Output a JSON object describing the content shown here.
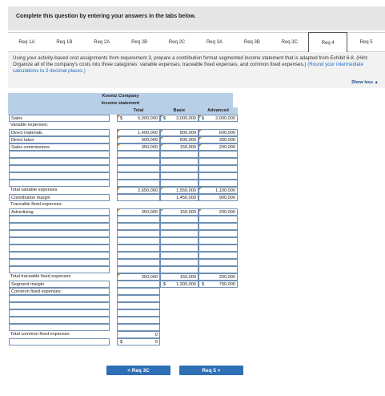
{
  "header": {
    "title": "Complete this question by entering your answers in the tabs below."
  },
  "tabs": [
    {
      "label": "Req 1A"
    },
    {
      "label": "Req 1B"
    },
    {
      "label": "Req 2A"
    },
    {
      "label": "Req 2B"
    },
    {
      "label": "Req 2C"
    },
    {
      "label": "Req 3A"
    },
    {
      "label": "Req 3B"
    },
    {
      "label": "Req 3C"
    },
    {
      "label": "Req 4"
    },
    {
      "label": "Req 5"
    }
  ],
  "active_tab": "Req 4",
  "instructions": {
    "text": "Using your activity-based cost assignments from requirement 3, prepare a contribution format segmented income statement that is adapted from Exhibit 6-8. (Hint: Organize all of the company's costs into three categories: variable expenses, traceable fixed expenses, and common fixed expenses.)",
    "note": "(Round your intermediate calculations to 2 decimal places.)",
    "show_less": "Show less ▲"
  },
  "statement": {
    "company": "Koontz Company",
    "title": "Income statement",
    "columns": [
      "Total",
      "Basic",
      "Advanced"
    ],
    "sales": {
      "label": "Sales",
      "total": "5,000,000",
      "basic": "3,000,000",
      "advanced": "2,000,000"
    },
    "variable_header": "Variable expenses:",
    "direct_materials": {
      "label": "Direct materials",
      "total": "1,400,000",
      "basic": "800,000",
      "advanced": "600,000"
    },
    "direct_labor": {
      "label": "Direct labor",
      "total": "900,000",
      "basic": "600,000",
      "advanced": "300,000"
    },
    "sales_commissions": {
      "label": "Sales commissions",
      "total": "350,000",
      "basic": "150,000",
      "advanced": "200,000"
    },
    "total_variable": {
      "label": "Total variable expenses",
      "total": "2,650,000",
      "basic": "1,550,000",
      "advanced": "1,100,000"
    },
    "contribution_margin": {
      "label": "Contribution margin",
      "basic": "1,450,000",
      "advanced": "900,000"
    },
    "traceable_header": "Traceable fixed expenses:",
    "advertising": {
      "label": "Advertising",
      "total": "350,000",
      "basic": "150,000",
      "advanced": "200,000"
    },
    "total_traceable": {
      "label": "Total traceable fixed expenses",
      "total": "350,000",
      "basic": "150,000",
      "advanced": "200,000"
    },
    "segment_margin": {
      "label": "Segment margin",
      "basic": "1,300,000",
      "advanced": "700,000"
    },
    "common_header": "Common fixed expenses:",
    "total_common": {
      "label": "Total common fixed expenses",
      "total": "0"
    },
    "net_operating": {
      "total": "0"
    },
    "dollar": "$"
  },
  "nav": {
    "prev": "<  Req 3C",
    "next": "Req 5  >"
  }
}
